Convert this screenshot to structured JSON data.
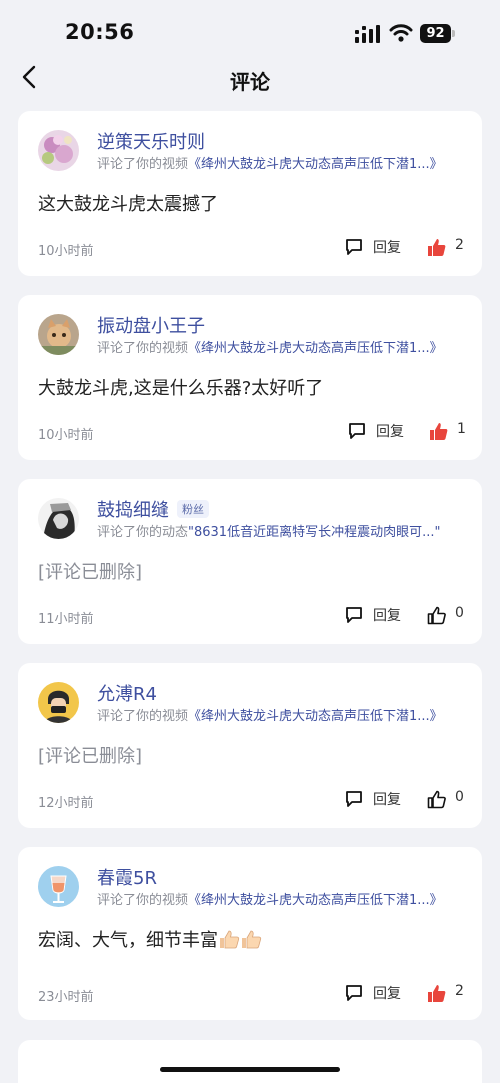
{
  "status_bar": {
    "time": "20:56",
    "battery": "92"
  },
  "header": {
    "title": "评论"
  },
  "comments": [
    {
      "user": "逆策天乐时则",
      "badge": "",
      "activity_prefix": "评论了你的视频",
      "activity_link": "《绛州大鼓龙斗虎大动态高声压低下潜1...》",
      "text": "这大鼓龙斗虎太震撼了",
      "deleted": false,
      "time": "10小时前",
      "reply": "回复",
      "likes": "2",
      "liked": true
    },
    {
      "user": "振动盘小王子",
      "badge": "",
      "activity_prefix": "评论了你的视频",
      "activity_link": "《绛州大鼓龙斗虎大动态高声压低下潜1...》",
      "text": "大鼓龙斗虎,这是什么乐器?太好听了",
      "deleted": false,
      "time": "10小时前",
      "reply": "回复",
      "likes": "1",
      "liked": true
    },
    {
      "user": "鼓捣细缝",
      "badge": "粉丝",
      "activity_prefix": "评论了你的动态",
      "activity_link": "\"8631低音近距离特写长冲程震动肉眼可...\"",
      "text": "[评论已删除]",
      "deleted": true,
      "time": "11小时前",
      "reply": "回复",
      "likes": "0",
      "liked": false
    },
    {
      "user": "允溥R4",
      "badge": "",
      "activity_prefix": "评论了你的视频",
      "activity_link": "《绛州大鼓龙斗虎大动态高声压低下潜1...》",
      "text": "[评论已删除]",
      "deleted": true,
      "time": "12小时前",
      "reply": "回复",
      "likes": "0",
      "liked": false
    },
    {
      "user": "春霞5R",
      "badge": "",
      "activity_prefix": "评论了你的视频",
      "activity_link": "《绛州大鼓龙斗虎大动态高声压低下潜1...》",
      "text": "宏阔、大气，细节丰富",
      "deleted": false,
      "time": "23小时前",
      "reply": "回复",
      "likes": "2",
      "liked": true
    }
  ],
  "colors": {
    "accent": "#3e4f9f",
    "like_active": "#e8453c",
    "background": "#f1f2f6"
  },
  "icons": {
    "back": "chevron-left-icon",
    "reply": "speech-bubble-icon",
    "like": "thumbs-up-icon"
  }
}
